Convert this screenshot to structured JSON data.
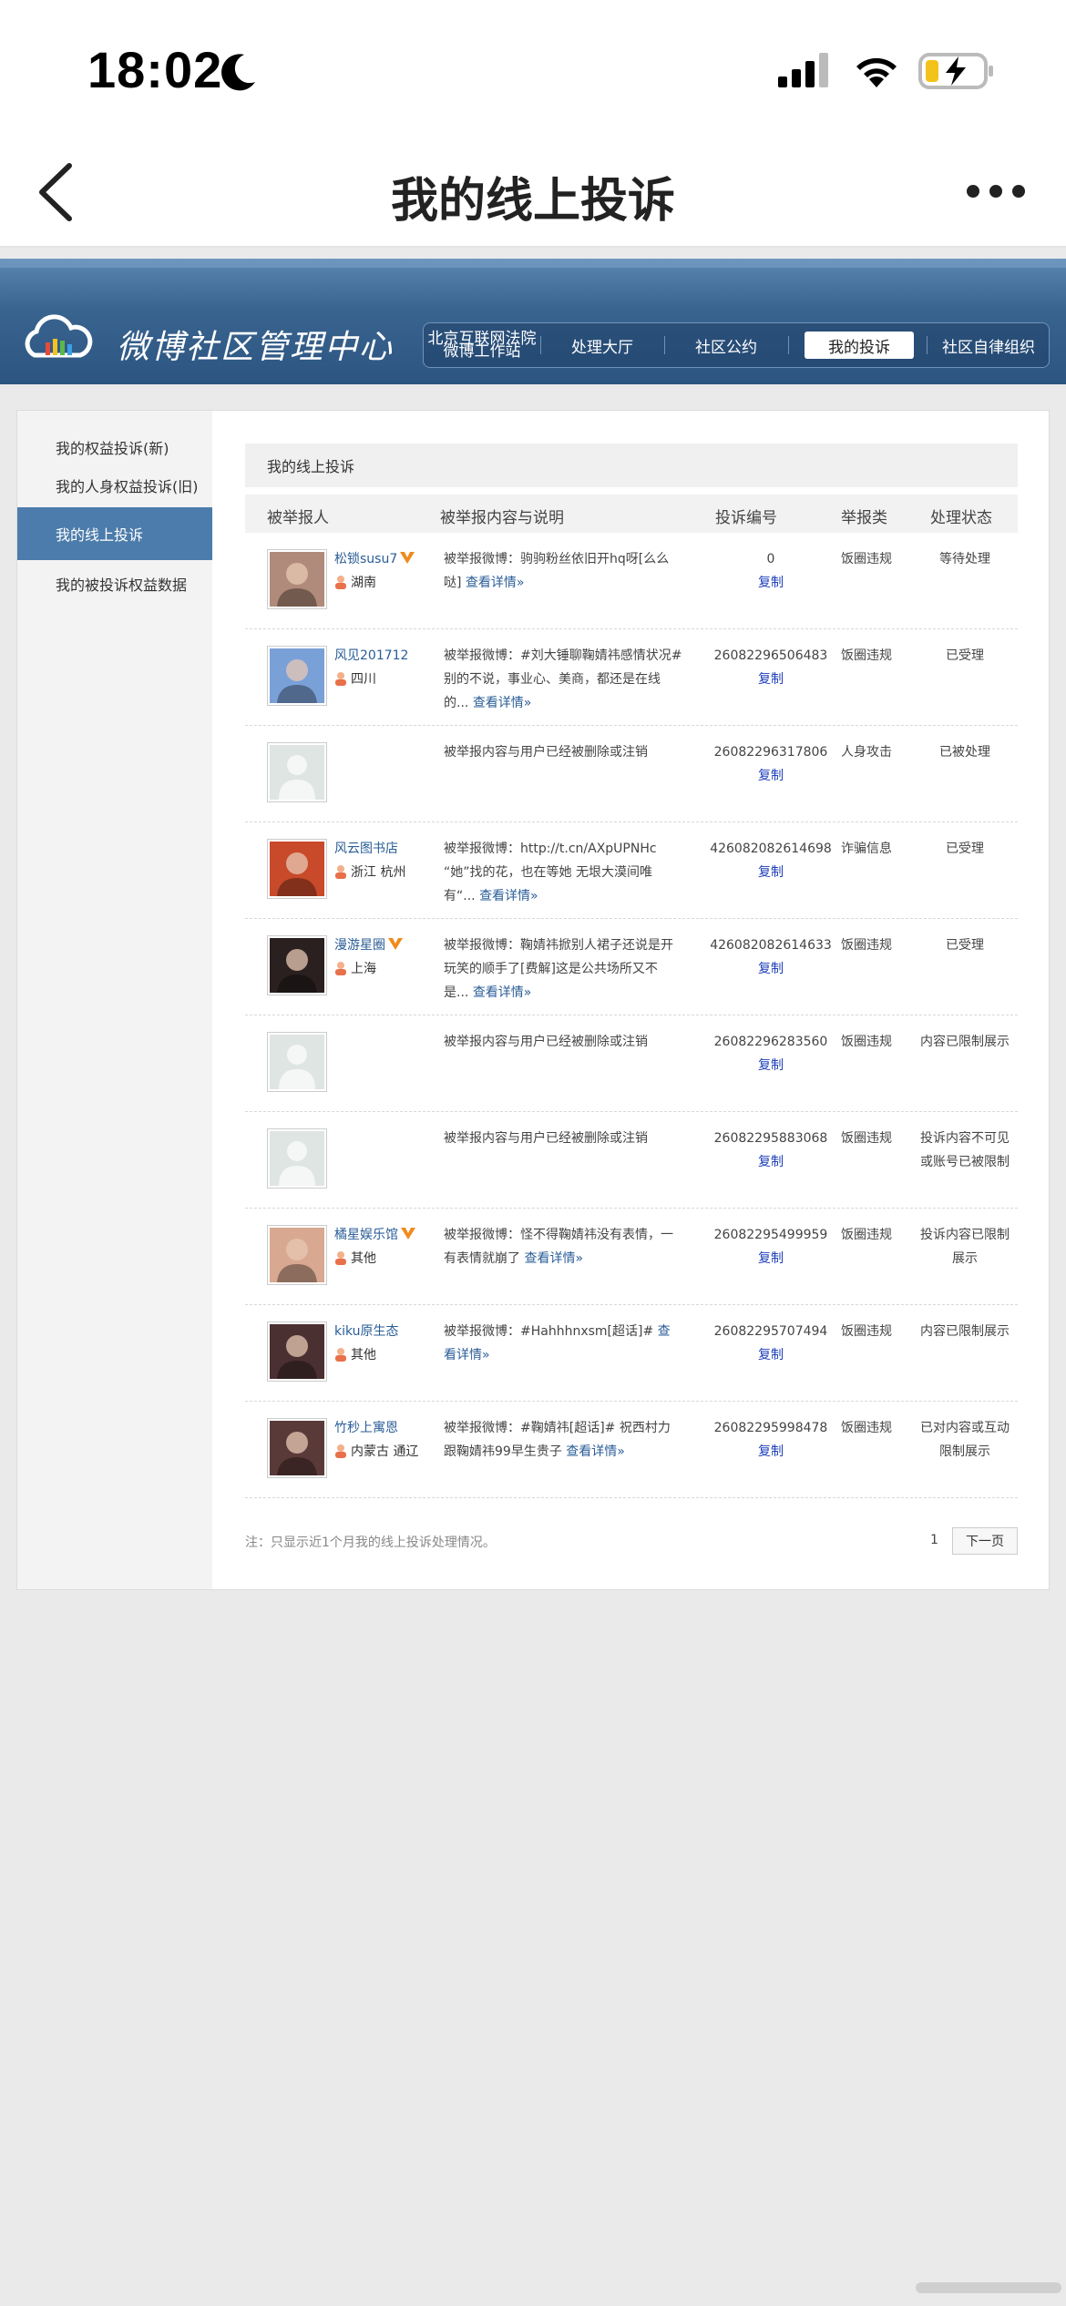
{
  "status_bar": {
    "time": "18:02"
  },
  "nav": {
    "title": "我的线上投诉"
  },
  "header": {
    "brand": "微博社区管理中心",
    "menu": {
      "court_line1": "北京互联网法院",
      "court_line2": "微博工作站",
      "hall": "处理大厅",
      "rules": "社区公约",
      "mine": "我的投诉",
      "org": "社区自律组织"
    }
  },
  "sidebar": {
    "items": [
      {
        "label": "我的权益投诉(新)"
      },
      {
        "label": "我的人身权益投诉(旧)"
      },
      {
        "label": "我的线上投诉"
      },
      {
        "label": "我的被投诉权益数据"
      }
    ]
  },
  "main": {
    "title": "我的线上投诉",
    "columns": {
      "user": "被举报人",
      "content": "被举报内容与说明",
      "id": "投诉编号",
      "type": "举报类",
      "status": "处理状态"
    },
    "copy_label": "复制",
    "detail_label": "查看详情»",
    "rows": [
      {
        "user": "松锁susu7",
        "verified": true,
        "location": "湖南",
        "desc": "被举报微博：驹驹粉丝依旧开hq呀[么么哒]",
        "id": "0",
        "type": "饭圈违规",
        "status": "等待处理",
        "avatar": "#b08a7a"
      },
      {
        "user": "风见201712",
        "verified": false,
        "location": "四川",
        "desc": "被举报微博：#刘大锤聊鞠婧祎感情状况#别的不说，事业心、美商，都还是在线的...",
        "id": "26082296506483",
        "type": "饭圈违规",
        "status": "已受理",
        "avatar": "#7aa0d8"
      },
      {
        "user": "",
        "verified": false,
        "location": "",
        "desc": "被举报内容与用户已经被删除或注销",
        "id": "26082296317806",
        "type": "人身攻击",
        "status": "已被处理",
        "avatar": "placeholder"
      },
      {
        "user": "风云图书店",
        "verified": false,
        "location": "浙江 杭州",
        "desc": "被举报微博：http://t.cn/AXpUPNHc “她”找的花，也在等她 无垠大漠间唯有“...",
        "id": "426082082614698",
        "type": "诈骗信息",
        "status": "已受理",
        "avatar": "#c84a2a"
      },
      {
        "user": "漫游星圈",
        "verified": true,
        "location": "上海",
        "desc": "被举报微博：鞠婧祎掀别人裙子还说是开玩笑的顺手了[费解]这是公共场所又不是...",
        "id": "426082082614633",
        "type": "饭圈违规",
        "status": "已受理",
        "avatar": "#2a2020"
      },
      {
        "user": "",
        "verified": false,
        "location": "",
        "desc": "被举报内容与用户已经被删除或注销",
        "id": "26082296283560",
        "type": "饭圈违规",
        "status": "内容已限制展示",
        "avatar": "placeholder"
      },
      {
        "user": "",
        "verified": false,
        "location": "",
        "desc": "被举报内容与用户已经被删除或注销",
        "id": "26082295883068",
        "type": "饭圈违规",
        "status": "投诉内容不可见或账号已被限制",
        "avatar": "placeholder"
      },
      {
        "user": "橘星娱乐馆",
        "verified": true,
        "location": "其他",
        "desc": "被举报微博：怪不得鞠婧祎没有表情，一有表情就崩了",
        "id": "26082295499959",
        "type": "饭圈违规",
        "status": "投诉内容已限制展示",
        "avatar": "#d8a890"
      },
      {
        "user": "kiku原生态",
        "verified": false,
        "location": "其他",
        "desc": "被举报微博：#Hahhhnxsm[超话]#",
        "id": "26082295707494",
        "type": "饭圈违规",
        "status": "内容已限制展示",
        "avatar": "#4a3030"
      },
      {
        "user": "竹秒上寓恩",
        "verified": false,
        "location": "内蒙古 通辽",
        "desc": "被举报微博：#鞠婧祎[超话]# 祝西村力跟鞠婧祎99早生贵子",
        "id": "26082295998478",
        "type": "饭圈违规",
        "status": "已对内容或互动限制展示",
        "avatar": "#5a3a38"
      }
    ],
    "footer_note": "注：只显示近1个月我的线上投诉处理情况。",
    "page_number": "1",
    "next_page": "下一页"
  }
}
